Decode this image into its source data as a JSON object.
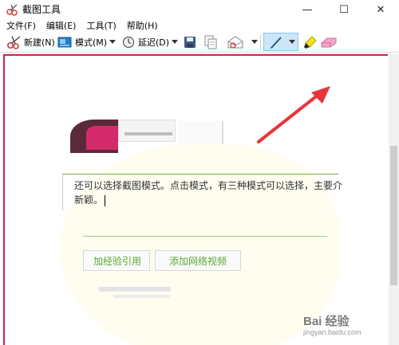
{
  "window": {
    "title": "截图工具",
    "minimize_glyph": "—",
    "maximize_glyph": "☐",
    "close_glyph": "✕"
  },
  "menu": [
    "文件(F)",
    "编辑(E)",
    "工具(T)",
    "帮助(H)"
  ],
  "toolbar": {
    "new_label": "新建(N)",
    "mode_label": "模式(M)",
    "delay_label": "延迟(D)",
    "icons": [
      "scissors-icon",
      "mode-icon",
      "clock-icon",
      "save-icon",
      "copy-icon",
      "send-icon",
      "pen-icon",
      "highlighter-icon",
      "eraser-icon"
    ]
  },
  "content": {
    "editor_line1": "还可以选择截图模式。点击模式，有三种模式可以选择，主要介",
    "editor_line2": "新颖。",
    "ref_button_1": "加经验引用",
    "ref_button_2": "添加网络视频"
  },
  "watermark": {
    "logo": "Bai 经验",
    "url": "jingyan.baidu.com"
  },
  "colors": {
    "accent_red": "#e8333a",
    "link_green": "#5ba832",
    "border_red": "#c8234a",
    "pen_highlight": "#cde6f7"
  }
}
